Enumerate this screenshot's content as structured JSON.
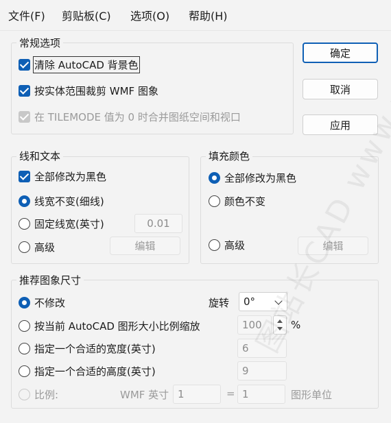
{
  "menu": {
    "file": "文件(F)",
    "clipboard": "剪贴板(C)",
    "options": "选项(O)",
    "help": "帮助(H)"
  },
  "general": {
    "title": "常规选项",
    "opt1": "清除 AutoCAD 背景色",
    "opt2": "按实体范围裁剪 WMF 图象",
    "opt3": "在 TILEMODE 值为 0 时合并图纸空间和视口"
  },
  "buttons": {
    "ok": "确定",
    "cancel": "取消",
    "apply": "应用"
  },
  "lines": {
    "title": "线和文本",
    "all_black": "全部修改为黑色",
    "width_unchanged": "线宽不变(细线)",
    "fixed_width": "固定线宽(英寸)",
    "fixed_width_value": "0.01",
    "advanced": "高级",
    "edit": "编辑"
  },
  "fill": {
    "title": "填充颜色",
    "all_black": "全部修改为黑色",
    "color_unchanged": "颜色不变",
    "advanced": "高级",
    "edit": "编辑"
  },
  "size": {
    "title": "推荐图象尺寸",
    "no_change": "不修改",
    "rotate_label": "旋转",
    "rotate_value": "0°",
    "scale_current": "按当前 AutoCAD 图形大小比例缩放",
    "scale_value": "100",
    "scale_unit": "%",
    "width_fit": "指定一个合适的宽度(英寸)",
    "width_value": "6",
    "height_fit": "指定一个合适的高度(英寸)",
    "height_value": "9",
    "ratio": "比例:",
    "wmf_label": "WMF 英寸",
    "wmf_value": "1",
    "equals": "=",
    "unit_value": "1",
    "unit_label": "图形单位"
  },
  "watermark": "图站长CAD www.zzcad.com"
}
